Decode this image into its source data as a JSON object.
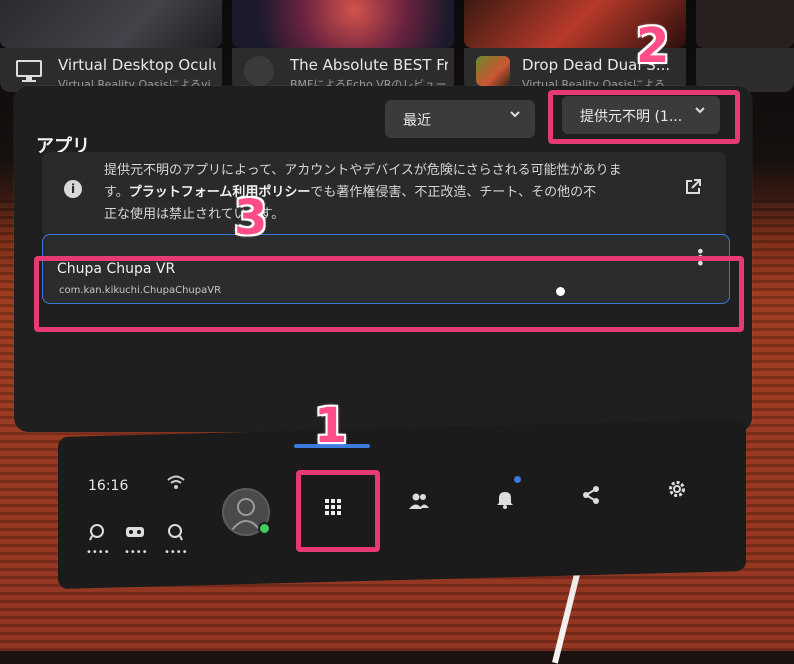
{
  "thumbnails": [
    {
      "title": "Virtual Desktop Oculu...",
      "subtitle": "Virtual Reality Oasisによるvi..."
    },
    {
      "title": "The Absolute BEST Fr...",
      "subtitle": "BMFによるEcho VRのレビュー"
    },
    {
      "title": "Drop Dead Dual S...",
      "subtitle": "Virtual Reality Oasisによる..."
    },
    {
      "title": "",
      "subtitle": ""
    }
  ],
  "panel": {
    "title": "アプリ",
    "sort_dropdown": "最近",
    "source_dropdown": "提供元不明 (1..."
  },
  "info_banner": {
    "line1": "提供元不明のアプリによって、アカウントやデバイスが危険にさらされる可能性がありま",
    "line2_pre": "す。",
    "line2_bold": "プラットフォーム利用ポリシー",
    "line2_post": "でも著作権侵害、不正改造、チート、その他の不",
    "line3": "正な使用は禁止されています。"
  },
  "app": {
    "name": "Chupa Chupa VR",
    "package": "com.kan.kikuchi.ChupaChupaVR"
  },
  "taskbar": {
    "time": "16:16",
    "controller_dots": "••••"
  },
  "annotations": {
    "n1": "1",
    "n2": "2",
    "n3": "3",
    "color": "#e83a72"
  }
}
